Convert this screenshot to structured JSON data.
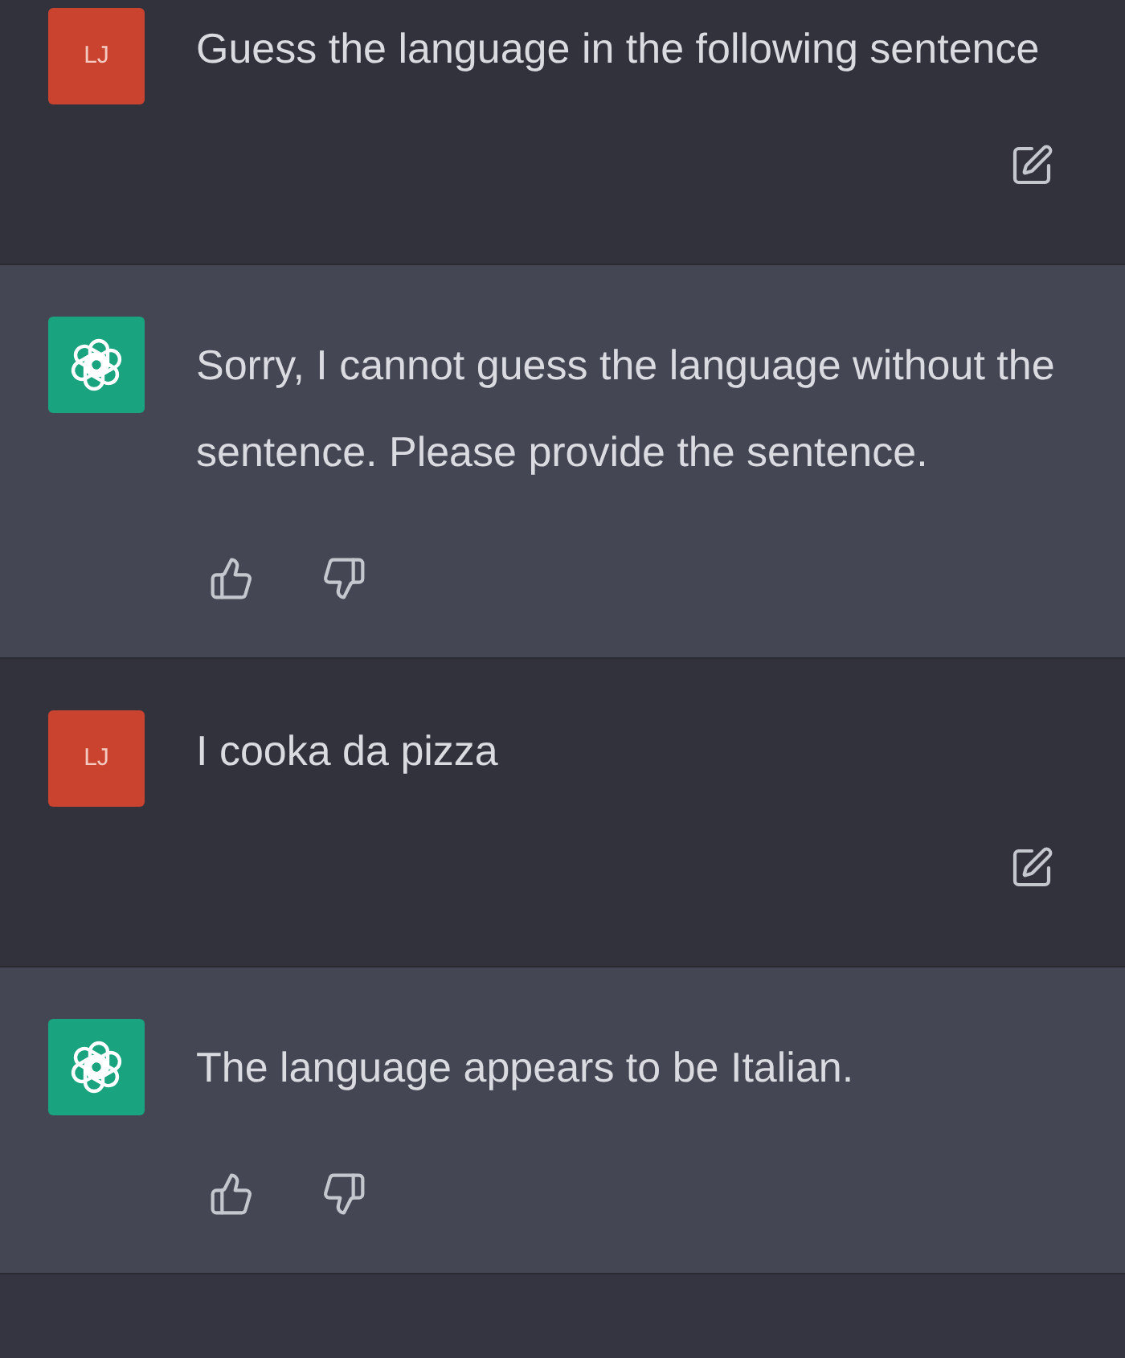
{
  "messages": [
    {
      "kind": "user",
      "avatar": "LJ",
      "text": "Guess the language in the following sentence"
    },
    {
      "kind": "assistant",
      "text": "Sorry, I cannot guess the language without the sentence. Please provide the sentence."
    },
    {
      "kind": "user",
      "avatar": "LJ",
      "text": "I cooka da pizza"
    },
    {
      "kind": "assistant",
      "text": "The language appears to be Italian."
    }
  ]
}
